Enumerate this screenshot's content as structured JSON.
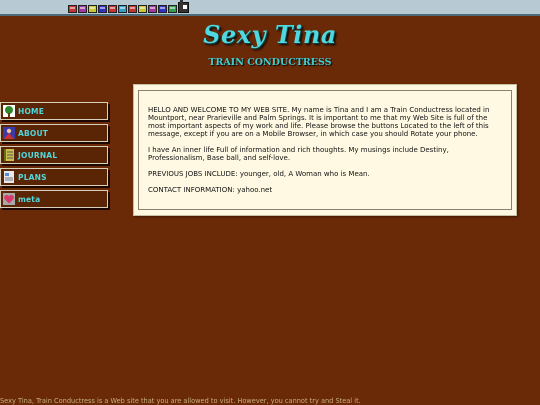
{
  "header": {
    "title": "Sexy Tina",
    "subtitle": "TRAIN CONDUCTRESS",
    "train_colors": [
      "#c83232",
      "#a03aa0",
      "#c8c832",
      "#3232c8",
      "#c83232",
      "#32a0c8",
      "#c83232",
      "#c8c832",
      "#a03aa0",
      "#3232c8",
      "#32a050"
    ]
  },
  "nav": {
    "items": [
      {
        "label": "HOME",
        "icon": "tree-icon"
      },
      {
        "label": "ABOUT",
        "icon": "person-icon"
      },
      {
        "label": "JOURNAL",
        "icon": "notebook-icon"
      },
      {
        "label": "PLANS",
        "icon": "document-icon"
      },
      {
        "label": "meta",
        "icon": "heart-icon"
      }
    ]
  },
  "content": {
    "welcome": "HELLO AND WELCOME TO MY WEB SITE. My name is Tina and I am a Train Conductress located in Mountport, near Prarieville and Palm Springs. It is important to me that my Web Site is full of the most important aspects of my work and life. Please browse the buttons Located to the left of this message, except if you are on a Mobile Browser, in which case you should Rotate your phone.",
    "inner_life": "I have An inner life Full of information and rich thoughts. My musings include Destiny, Professionalism, Base ball, and self-love.",
    "previous_jobs": "PREVIOUS JOBS INCLUDE: younger, old, A Woman who is Mean.",
    "contact": "CONTACT INFORMATION: yahoo.net"
  },
  "footer": {
    "text": "Sexy Tina, Train Conductress is a Web site that you are allowed to visit. However, you cannot try and Steal it."
  },
  "colors": {
    "background": "#6b2a07",
    "accent": "#4fd8dd",
    "panel": "#fff9e3"
  }
}
